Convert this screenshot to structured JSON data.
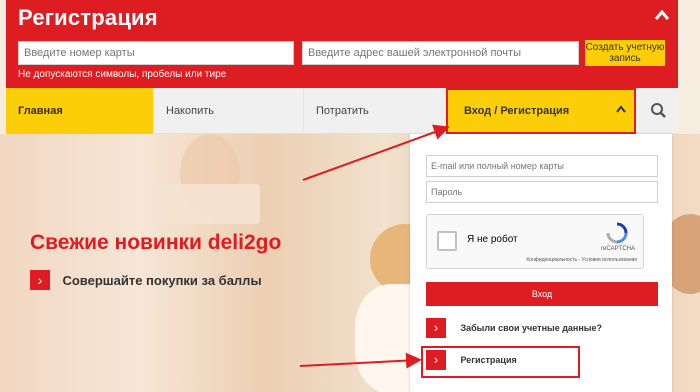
{
  "registration": {
    "title": "Регистрация",
    "card_placeholder": "Введите номер карты",
    "email_placeholder": "Введите адрес вашей электронной почты",
    "hint": "Не допускаются символы, пробелы или тире",
    "create_button": "Создать учетную запись"
  },
  "nav": {
    "home": "Главная",
    "accumulate": "Накопить",
    "spend": "Потратить",
    "login_register": "Вход / Регистрация"
  },
  "promo": {
    "title": "Свежие новинки deli2go",
    "link": "Совершайте покупки за баллы"
  },
  "login_panel": {
    "email_placeholder": "E-mail или полный номер карты",
    "password_placeholder": "Пароль",
    "captcha_label": "Я не робот",
    "captcha_brand": "reCAPTCHA",
    "captcha_terms": "Конфиденциальность - Условия использования",
    "login_button": "Вход",
    "forgot_link": "Забыли свои учетные данные?",
    "register_link": "Регистрация"
  },
  "colors": {
    "brand_red": "#dd1d21",
    "brand_yellow": "#fbce07"
  },
  "icons": [
    "chevron-up-icon",
    "chevron-up-icon",
    "search-icon",
    "chevron-right-icon",
    "recaptcha-icon"
  ]
}
